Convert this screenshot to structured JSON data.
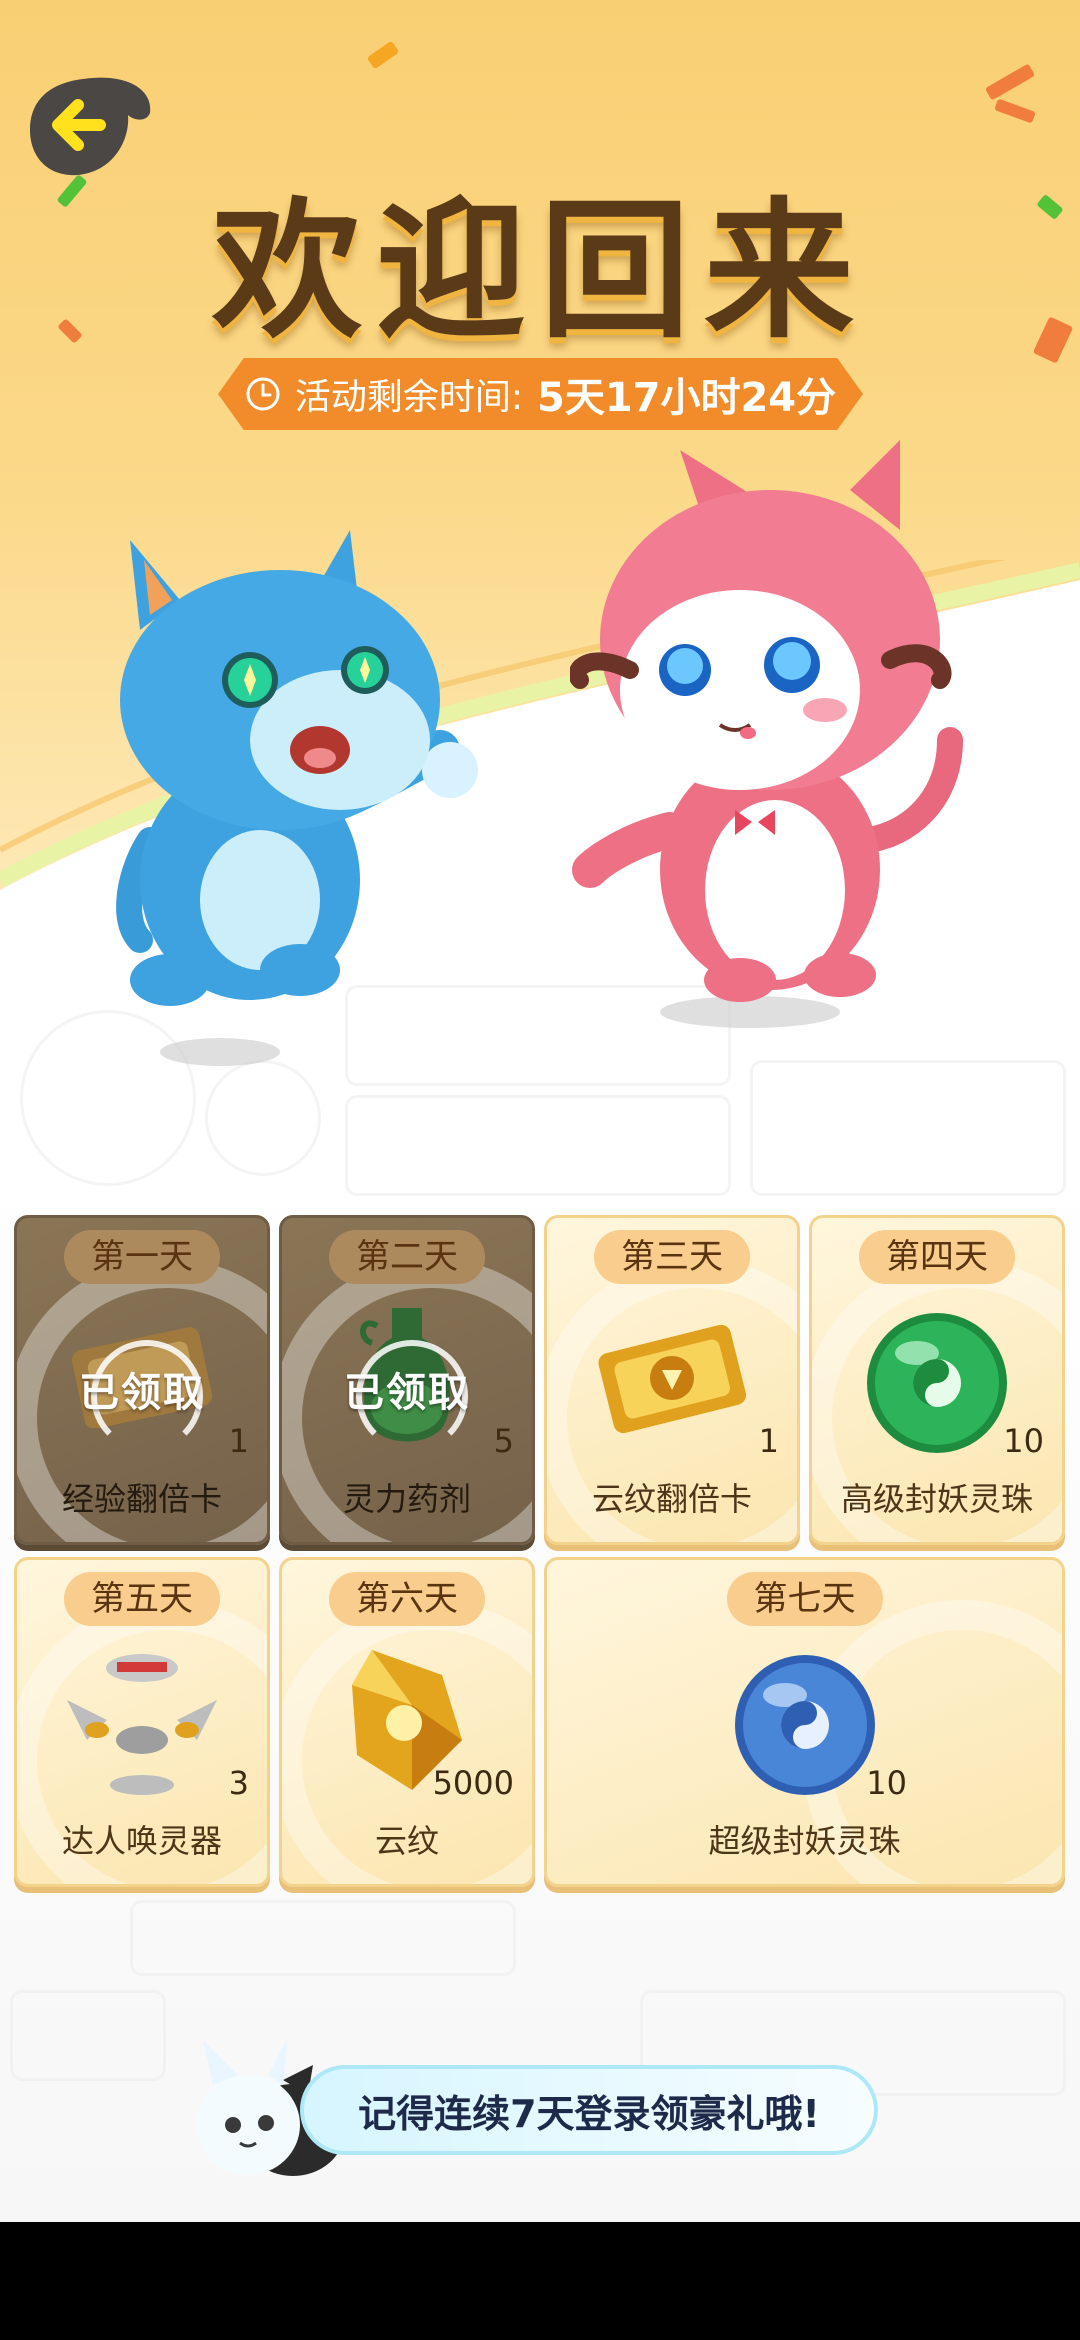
{
  "header": {
    "title": "欢迎回来",
    "timer_label": "活动剩余时间:",
    "timer_value": "5天17小时24分"
  },
  "rewards": [
    {
      "day": "第一天",
      "item": "经验翻倍卡",
      "count": "1",
      "claimed": true,
      "claimed_label": "已领取",
      "icon": "ticket-icon"
    },
    {
      "day": "第二天",
      "item": "灵力药剂",
      "count": "5",
      "claimed": true,
      "claimed_label": "已领取",
      "icon": "potion-icon"
    },
    {
      "day": "第三天",
      "item": "云纹翻倍卡",
      "count": "1",
      "claimed": false,
      "icon": "gold-ticket-icon"
    },
    {
      "day": "第四天",
      "item": "高级封妖灵珠",
      "count": "10",
      "claimed": false,
      "icon": "green-orb-icon"
    },
    {
      "day": "第五天",
      "item": "达人唤灵器",
      "count": "3",
      "claimed": false,
      "icon": "summoner-device-icon"
    },
    {
      "day": "第六天",
      "item": "云纹",
      "count": "5000",
      "claimed": false,
      "icon": "crystal-icon"
    },
    {
      "day": "第七天",
      "item": "超级封妖灵珠",
      "count": "10",
      "claimed": false,
      "icon": "blue-orb-icon"
    }
  ],
  "reminder": {
    "text": "记得连续7天登录领豪礼哦!"
  },
  "colors": {
    "accent_orange": "#f28c2a",
    "title_brown": "#5b3a17",
    "card_bg": "#fbe6b0",
    "claimed_bg": "#75624a"
  }
}
